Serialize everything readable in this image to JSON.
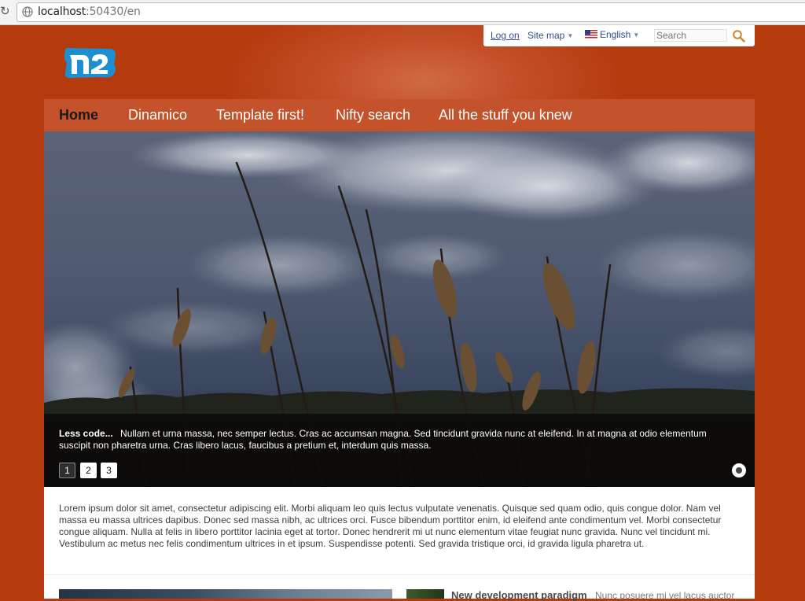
{
  "browser": {
    "url_host": "localhost",
    "url_rest": ":50430/en"
  },
  "utility": {
    "login": "Log on",
    "sitemap": "Site map",
    "language": "English",
    "search_placeholder": "Search"
  },
  "nav": {
    "items": [
      {
        "label": "Home",
        "active": true
      },
      {
        "label": "Dinamico",
        "active": false
      },
      {
        "label": "Template first!",
        "active": false
      },
      {
        "label": "Nifty search",
        "active": false
      },
      {
        "label": "All the stuff you knew",
        "active": false
      }
    ]
  },
  "hero": {
    "caption_title": "Less code...",
    "caption_text": "Nullam et urna massa, nec semper lectus. Cras ac accumsan magna. Sed tincidunt gravida nunc at eleifend. In at magna at odio elementum suscipit non pharetra urna. Cras libero lacus, faucibus a pretium et, interdum quis massa.",
    "pages": [
      "1",
      "2",
      "3"
    ],
    "active_page": "1"
  },
  "content": {
    "intro": "Lorem ipsum dolor sit amet, consectetur adipiscing elit. Morbi aliquam leo quis lectus vulputate venenatis. Quisque sed quam odio, quis congue dolor. Nam vel massa eu massa ultrices dapibus. Donec sed massa nibh, ac ultrices orci. Fusce bibendum porttitor enim, id eleifend ante condimentum vel. Morbi consectetur congue aliquam. Nulla at felis in libero porttitor lacinia eget at tortor. Donec hendrerit mi ut nunc elementum vitae feugiat nunc gravida. Nunc vel tincidunt mi. Vestibulum ac metus nec felis condimentum ultrices in et ipsum. Suspendisse potenti. Sed gravida tristique orci, id gravida ligula pharetra ut.",
    "teaser_title": "New development paradigm",
    "teaser_text": "Nunc posuere mi vel lacus auctor"
  }
}
